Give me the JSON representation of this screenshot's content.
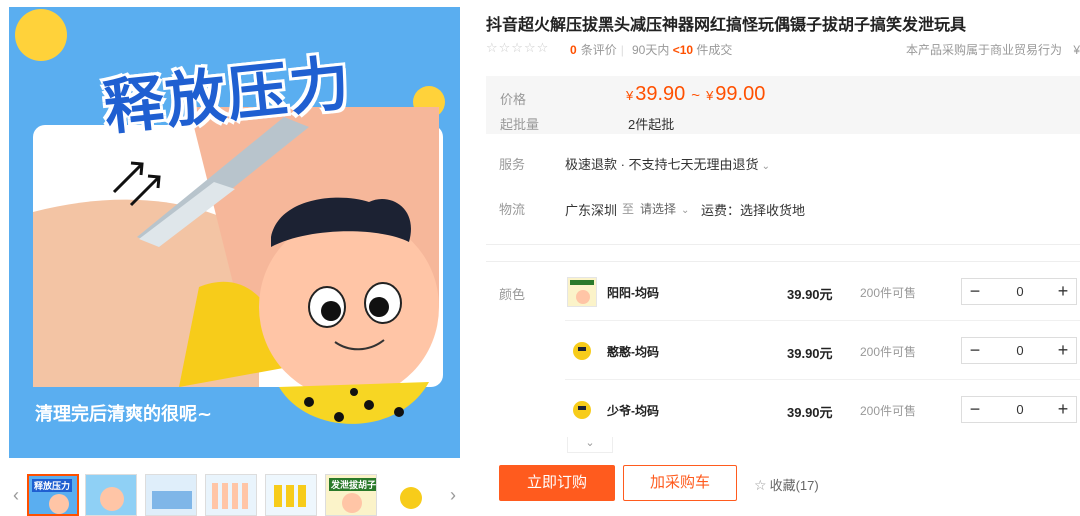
{
  "gallery": {
    "main_image_headline": "释放压力",
    "main_image_caption": "清理完后清爽的很呢~",
    "thumb_captions": [
      "释放压力",
      "",
      "",
      "",
      "",
      "发泄拔胡子",
      ""
    ],
    "prev_glyph": "‹",
    "next_glyph": "›"
  },
  "product": {
    "title": "抖音超火解压拔黑头减压神器网红搞怪玩偶镊子拔胡子搞笑发泄玩具",
    "stars": "☆☆☆☆☆",
    "review_count": "0",
    "review_suffix": "条评价",
    "sold_prefix": "90天内",
    "sold_count": "<10",
    "sold_suffix": "件成交",
    "trade_note": "本产品采购属于商业贸易行为",
    "trade_note_tail": "¥"
  },
  "pricing": {
    "price_label": "价格",
    "currency": "¥",
    "price_low": "39.90",
    "price_sep": "~",
    "price_high": "99.00",
    "moq_label": "起批量",
    "moq_value": "2件起批"
  },
  "service": {
    "label": "服务",
    "value": "极速退款 · 不支持七天无理由退货"
  },
  "logistics": {
    "label": "物流",
    "from": "广东深圳",
    "to": "至",
    "select": "请选择",
    "fee": "运费：选择收货地"
  },
  "sku": {
    "color_label": "颜色",
    "items": [
      {
        "name": "阳阳-均码",
        "price": "39.90元",
        "stock": "200件可售",
        "qty": "0"
      },
      {
        "name": "憨憨-均码",
        "price": "39.90元",
        "stock": "200件可售",
        "qty": "0"
      },
      {
        "name": "少爷-均码",
        "price": "39.90元",
        "stock": "200件可售",
        "qty": "0"
      }
    ],
    "minus_glyph": "−",
    "plus_glyph": "+",
    "expand_glyph": "⌄"
  },
  "actions": {
    "order": "立即订购",
    "cart": "加采购车",
    "favorite": "收藏(17)"
  },
  "colors": {
    "accent": "#ff5000",
    "button": "#ff5b1e",
    "banner_blue": "#1f5fd1"
  }
}
